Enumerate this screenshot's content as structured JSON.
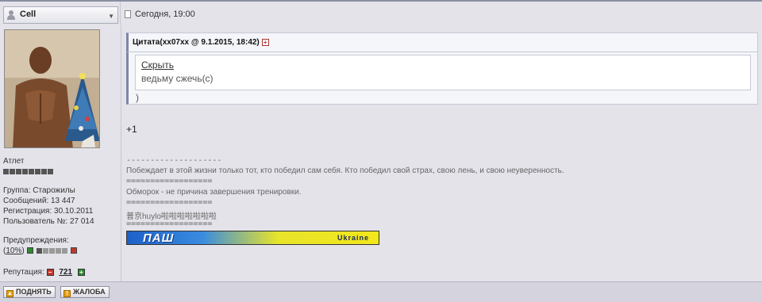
{
  "header": {
    "username": "Cell",
    "post_date": "Сегодня, 19:00"
  },
  "user": {
    "rank": "Атлет",
    "group": "Группа: Старожилы",
    "messages": "Сообщений: 13 447",
    "registered": "Регистрация: 30.10.2011",
    "user_number": "Пользователь №: 27 014",
    "warnings_label": "Предупреждения:",
    "warnings_value": "10%",
    "reputation_label": "Репутация:",
    "reputation_value": "721",
    "rank_pips": 8,
    "warning_level": 0.1
  },
  "post": {
    "quote_title": "Цитата(xx07xx @ 9.1.2015, 18:42)",
    "quote_hide": "Скрыть",
    "quote_text": "ведьму сжечь(с)",
    "quote_close": ")",
    "body": "+1"
  },
  "signature": {
    "sep1": "--------------------",
    "line1": "Побеждает в этой жизни только тот, кто победил сам себя. Кто победил свой страх, свою лень, и свою неуверенность.",
    "sep2": "==================",
    "line2": "Обморок - не причина завершения тренировки.",
    "sep3": "==================",
    "line3": "普京huylo啦啦啦啦啦啦啦",
    "sep4": "==================",
    "banner_logo": "ПАШ",
    "banner_country": "Ukraine"
  },
  "actions": {
    "raise": "ПОДНЯТЬ",
    "report": "ЖАЛОБА"
  },
  "colors": {
    "background": "#e4e3ea",
    "quote_border": "#7e85a8",
    "rep_minus": "#c0392b",
    "rep_plus": "#2e8b2e"
  }
}
